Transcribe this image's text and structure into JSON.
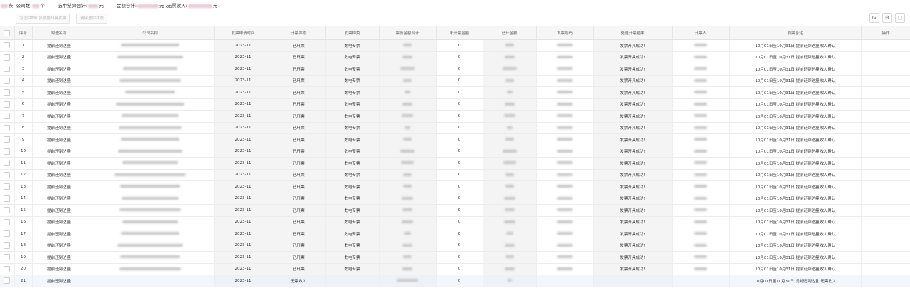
{
  "summary": {
    "text1_suffix": "条, 公司数:",
    "text2_suffix": "个",
    "text3_label": "选中结果合计:",
    "text3_suffix": "元",
    "text4_label": "金额合计:",
    "text4_mid": "元 ,无票收入:",
    "text4_suffix": "元"
  },
  "toolbar": {
    "btn_open_label": "为选中的0 张数据开具发票",
    "btn_clear_label": "清除选中状态",
    "icon_export": "Ⅳ",
    "icon_settings": "⚙",
    "icon_extra": "▢"
  },
  "table": {
    "headers": [
      "",
      "序号",
      "勾选名称",
      "公司名称",
      "发票申请时间",
      "开票状态",
      "发票种类",
      "票价金额合计",
      "未开票金额",
      "已开金额",
      "发票号码",
      "处理开票结果",
      "开票人",
      "发票备注",
      "操作"
    ],
    "rows": [
      {
        "no": "1",
        "name": "提前还到达量",
        "period": "2023-11",
        "status": "已开票",
        "kind": "数电专票",
        "unbilled": "0",
        "result": "发票开具成功!",
        "remark": "10月01日至10月31日 提前还到达量收入确认"
      },
      {
        "no": "2",
        "name": "提前还到达量",
        "period": "2023-11",
        "status": "已开票",
        "kind": "数电专票",
        "unbilled": "0",
        "result": "发票开具成功!",
        "remark": "10月01日至10月31日 提前还到达量收入确认"
      },
      {
        "no": "3",
        "name": "提前还到达量",
        "period": "2023-11",
        "status": "已开票",
        "kind": "数电专票",
        "unbilled": "0",
        "result": "发票开具成功!",
        "remark": "10月01日至10月31日 提前还到达量收入确认"
      },
      {
        "no": "4",
        "name": "提前还到达量",
        "period": "2023-11",
        "status": "已开票",
        "kind": "数电专票",
        "unbilled": "0",
        "result": "发票开具成功!",
        "remark": "10月01日至10月31日 提前还到达量收入确认"
      },
      {
        "no": "5",
        "name": "提前还到达量",
        "period": "2023-11",
        "status": "已开票",
        "kind": "数电专票",
        "unbilled": "0",
        "result": "发票开具成功!",
        "remark": "10月01日至10月31日 提前还到达量收入确认"
      },
      {
        "no": "6",
        "name": "提前还到达量",
        "period": "2023-11",
        "status": "已开票",
        "kind": "数电专票",
        "unbilled": "0",
        "result": "发票开具成功!",
        "remark": "10月01日至10月31日 提前还到达量收入确认"
      },
      {
        "no": "7",
        "name": "提前还到达量",
        "period": "2023-11",
        "status": "已开票",
        "kind": "数电专票",
        "unbilled": "0",
        "result": "发票开具成功!",
        "remark": "10月01日至10月31日 提前还到达量收入确认"
      },
      {
        "no": "8",
        "name": "提前还到达量",
        "period": "2023-11",
        "status": "已开票",
        "kind": "数电专票",
        "unbilled": "0",
        "result": "发票开具成功!",
        "remark": "10月01日至10月31日 提前还到达量收入确认"
      },
      {
        "no": "9",
        "name": "提前还到达量",
        "period": "2023-11",
        "status": "已开票",
        "kind": "数电专票",
        "unbilled": "0",
        "result": "发票开具成功!",
        "remark": "10月01日至10月31日 提前还到达量收入确认"
      },
      {
        "no": "10",
        "name": "提前还到达量",
        "period": "2023-11",
        "status": "已开票",
        "kind": "数电专票",
        "unbilled": "0",
        "result": "发票开具成功!",
        "remark": "10月01日至10月31日 提前还到达量收入确认"
      },
      {
        "no": "11",
        "name": "提前还到达量",
        "period": "2023-11",
        "status": "已开票",
        "kind": "数电专票",
        "unbilled": "0",
        "result": "发票开具成功!",
        "remark": "10月01日至10月31日 提前还到达量收入确认"
      },
      {
        "no": "12",
        "name": "提前还到达量",
        "period": "2023-11",
        "status": "已开票",
        "kind": "数电专票",
        "unbilled": "0",
        "result": "发票开具成功!",
        "remark": "10月01日至10月31日 提前还到达量收入确认"
      },
      {
        "no": "13",
        "name": "提前还到达量",
        "period": "2023-11",
        "status": "已开票",
        "kind": "数电专票",
        "unbilled": "0",
        "result": "发票开具成功!",
        "remark": "10月01日至10月31日 提前还到达量收入确认"
      },
      {
        "no": "14",
        "name": "提前还到达量",
        "period": "2023-11",
        "status": "已开票",
        "kind": "数电专票",
        "unbilled": "0",
        "result": "发票开具成功!",
        "remark": "10月01日至10月31日 提前还到达量收入确认"
      },
      {
        "no": "15",
        "name": "提前还到达量",
        "period": "2023-11",
        "status": "已开票",
        "kind": "数电专票",
        "unbilled": "0",
        "result": "发票开具成功!",
        "remark": "10月01日至10月31日 提前还到达量收入确认"
      },
      {
        "no": "16",
        "name": "提前还到达量",
        "period": "2023-11",
        "status": "已开票",
        "kind": "数电专票",
        "unbilled": "0",
        "result": "发票开具成功!",
        "remark": "10月01日至10月31日 提前还到达量收入确认"
      },
      {
        "no": "17",
        "name": "提前还到达量",
        "period": "2023-11",
        "status": "已开票",
        "kind": "数电专票",
        "unbilled": "0",
        "result": "发票开具成功!",
        "remark": "10月01日至10月31日 提前还到达量收入确认"
      },
      {
        "no": "18",
        "name": "提前还到达量",
        "period": "2023-11",
        "status": "已开票",
        "kind": "数电专票",
        "unbilled": "0",
        "result": "发票开具成功!",
        "remark": "10月01日至10月31日 提前还到达量收入确认"
      },
      {
        "no": "19",
        "name": "提前还到达量",
        "period": "2023-11",
        "status": "已开票",
        "kind": "数电专票",
        "unbilled": "0",
        "result": "发票开具成功!",
        "remark": "10月01日至10月31日 提前还到达量收入确认"
      },
      {
        "no": "20",
        "name": "提前还到达量",
        "period": "2023-11",
        "status": "已开票",
        "kind": "数电专票",
        "unbilled": "0",
        "result": "发票开具成功!",
        "remark": "10月01日至10月31日 提前还到达量收入确认"
      },
      {
        "no": "21",
        "name": "提前还到达量",
        "period": "2023-11",
        "status": "无票收入",
        "kind": "",
        "unbilled": "0",
        "result": "",
        "remark": "10月01日至10月31日 提前还到达量 无票收入"
      }
    ]
  }
}
